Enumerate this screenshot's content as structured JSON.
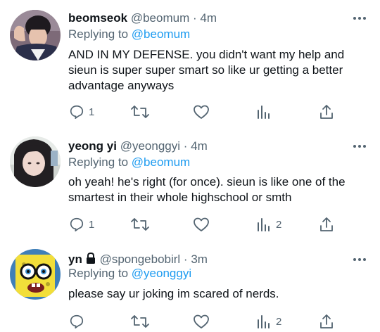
{
  "tweets": [
    {
      "display_name": "beomseok",
      "handle": "@beomum",
      "separator": "·",
      "time": "4m",
      "replying_prefix": "Replying to",
      "replying_to": "@beomum",
      "text": "AND IN MY DEFENSE. you didn't want my help and sieun is super super smart so like ur getting a better advantage anyways",
      "reply_count": "1",
      "retweet_count": "",
      "like_count": "",
      "views_count": "",
      "avatar_icon": "avatar-photo-boy"
    },
    {
      "display_name": "yeong yi",
      "handle": "@yeonggyi",
      "separator": "·",
      "time": "4m",
      "replying_prefix": "Replying to",
      "replying_to": "@beomum",
      "text": "oh yeah! he's right (for once). sieun is like one of the smartest in their whole highschool or smth",
      "reply_count": "1",
      "retweet_count": "",
      "like_count": "",
      "views_count": "2",
      "avatar_icon": "avatar-photo-girl"
    },
    {
      "display_name": "yn",
      "handle": "@spongebobirl",
      "separator": "·",
      "time": "3m",
      "replying_prefix": "Replying to",
      "replying_to": "@yeonggyi",
      "text": "please say ur joking im scared of nerds.",
      "reply_count": "",
      "retweet_count": "",
      "like_count": "",
      "views_count": "2",
      "avatar_icon": "avatar-spongebob",
      "locked": true
    }
  ],
  "colors": {
    "text": "#0f1419",
    "secondary": "#536471",
    "link": "#1d9bf0"
  },
  "icons": [
    "more-icon",
    "reply-icon",
    "retweet-icon",
    "like-icon",
    "views-icon",
    "share-icon",
    "lock-icon"
  ]
}
